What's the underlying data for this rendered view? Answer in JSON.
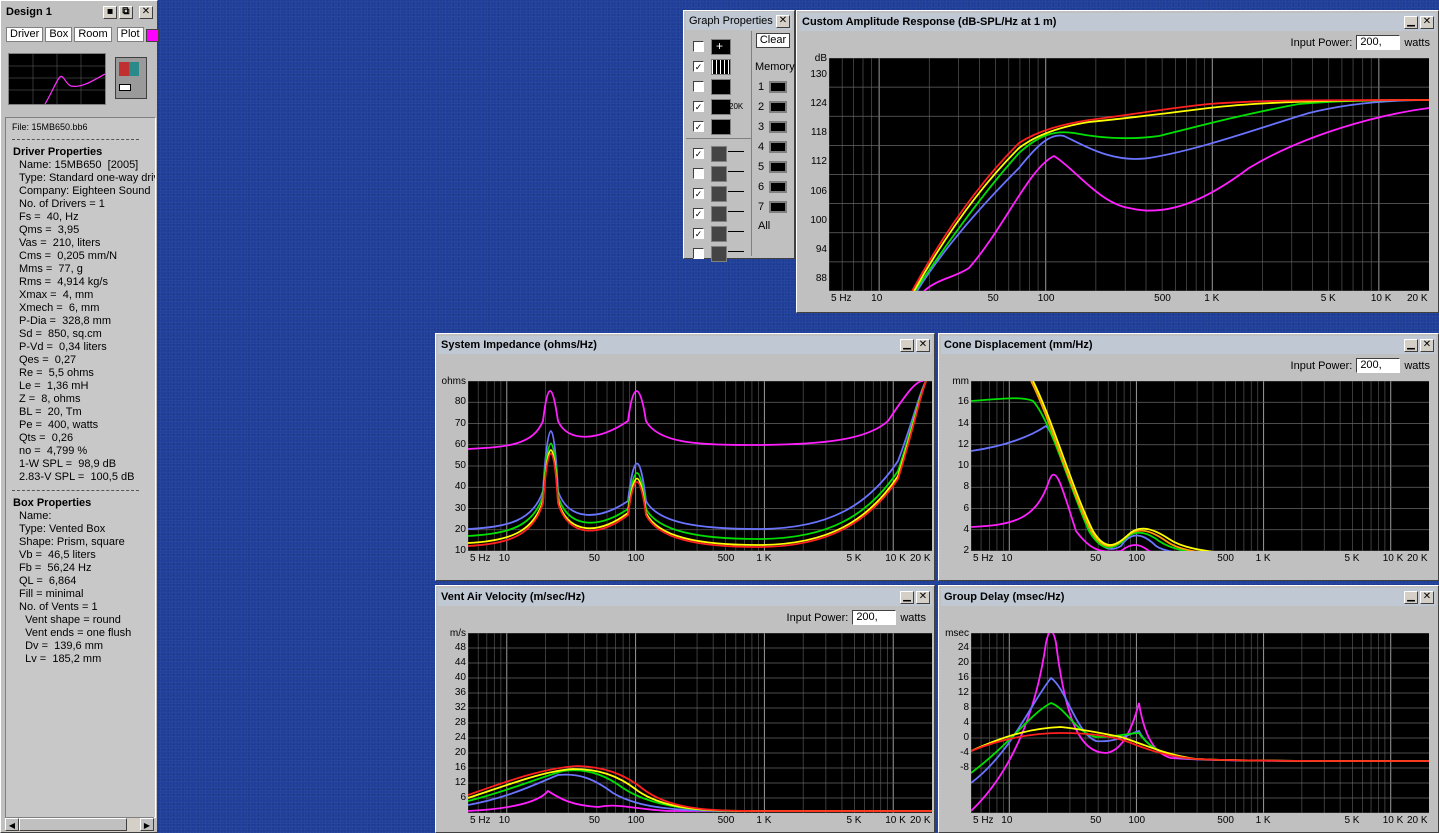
{
  "design_window": {
    "title": "Design 1",
    "tabs": [
      "Driver",
      "Box",
      "Room",
      "Plot"
    ],
    "plot_color": "#ff00ff",
    "file": "File: 15MB650.bb6",
    "driver_heading": "Driver Properties",
    "driver_lines": [
      "Name: 15MB650  [2005]",
      "Type: Standard one-way driv",
      "Company: Eighteen Sound",
      "No. of Drivers = 1",
      "Fs =  40, Hz",
      "Qms =  3,95",
      "Vas =  210, liters",
      "Cms =  0,205 mm/N",
      "Mms =  77, g",
      "Rms =  4,914 kg/s",
      "Xmax =  4, mm",
      "Xmech =  6, mm",
      "P-Dia =  328,8 mm",
      "Sd =  850, sq.cm",
      "P-Vd =  0,34 liters",
      "Qes =  0,27",
      "Re =  5,5 ohms",
      "Le =  1,36 mH",
      "Z =  8, ohms",
      "BL =  20, Tm",
      "Pe =  400, watts",
      "Qts =  0,26",
      "no =  4,799 %",
      "1-W SPL =  98,9 dB",
      "2.83-V SPL =  100,5 dB"
    ],
    "box_heading": "Box Properties",
    "box_lines": [
      "Name:",
      "Type: Vented Box",
      "Shape: Prism, square",
      "Vb =  46,5 liters",
      "Fb =  56,24 Hz",
      "QL =  6,864",
      "Fill = minimal",
      "No. of Vents = 1",
      "  Vent shape = round",
      "  Vent ends = one flush",
      "  Dv =  139,6 mm",
      "  Lv =  185,2 mm"
    ]
  },
  "graph_properties": {
    "title": "Graph Properties",
    "clear_label": "Clear",
    "memory_label": "Memory",
    "memory_slots": [
      "1",
      "2",
      "3",
      "4",
      "5",
      "6",
      "7"
    ],
    "all_label": "All",
    "top_checks": [
      false,
      true,
      false,
      true,
      true
    ],
    "bottom_checks": [
      true,
      false,
      true,
      true,
      true,
      false
    ]
  },
  "x_ticks": [
    "5 Hz",
    "10",
    "50",
    "100",
    "500",
    "1 K",
    "5 K",
    "10 K",
    "20 K"
  ],
  "power": {
    "label": "Input Power:",
    "value": "200,",
    "unit": "watts"
  },
  "series_colors": {
    "red": "#ff2020",
    "orange": "#ff9900",
    "yellow": "#ffff00",
    "green": "#00e000",
    "blue": "#6a74ff",
    "magenta": "#ff20ff"
  },
  "graphs": {
    "amplitude": {
      "title": "Custom Amplitude Response (dB-SPL/Hz at 1 m)",
      "unit": "dB",
      "y_ticks": [
        "130",
        "124",
        "118",
        "112",
        "106",
        "100",
        "94",
        "88"
      ]
    },
    "impedance": {
      "title": "System Impedance (ohms/Hz)",
      "unit": "ohms",
      "y_ticks": [
        "80",
        "70",
        "60",
        "50",
        "40",
        "30",
        "20",
        "10"
      ]
    },
    "displacement": {
      "title": "Cone Displacement (mm/Hz)",
      "unit": "mm",
      "y_ticks": [
        "16",
        "14",
        "12",
        "10",
        "8",
        "6",
        "4",
        "2"
      ]
    },
    "velocity": {
      "title": "Vent Air Velocity (m/sec/Hz)",
      "unit": "m/s",
      "y_ticks": [
        "48",
        "44",
        "40",
        "36",
        "32",
        "28",
        "24",
        "20",
        "16",
        "12",
        "6"
      ]
    },
    "delay": {
      "title": "Group Delay (msec/Hz)",
      "unit": "msec",
      "y_ticks": [
        "24",
        "20",
        "16",
        "12",
        "8",
        "4",
        "0",
        "-4",
        "-8"
      ]
    }
  }
}
